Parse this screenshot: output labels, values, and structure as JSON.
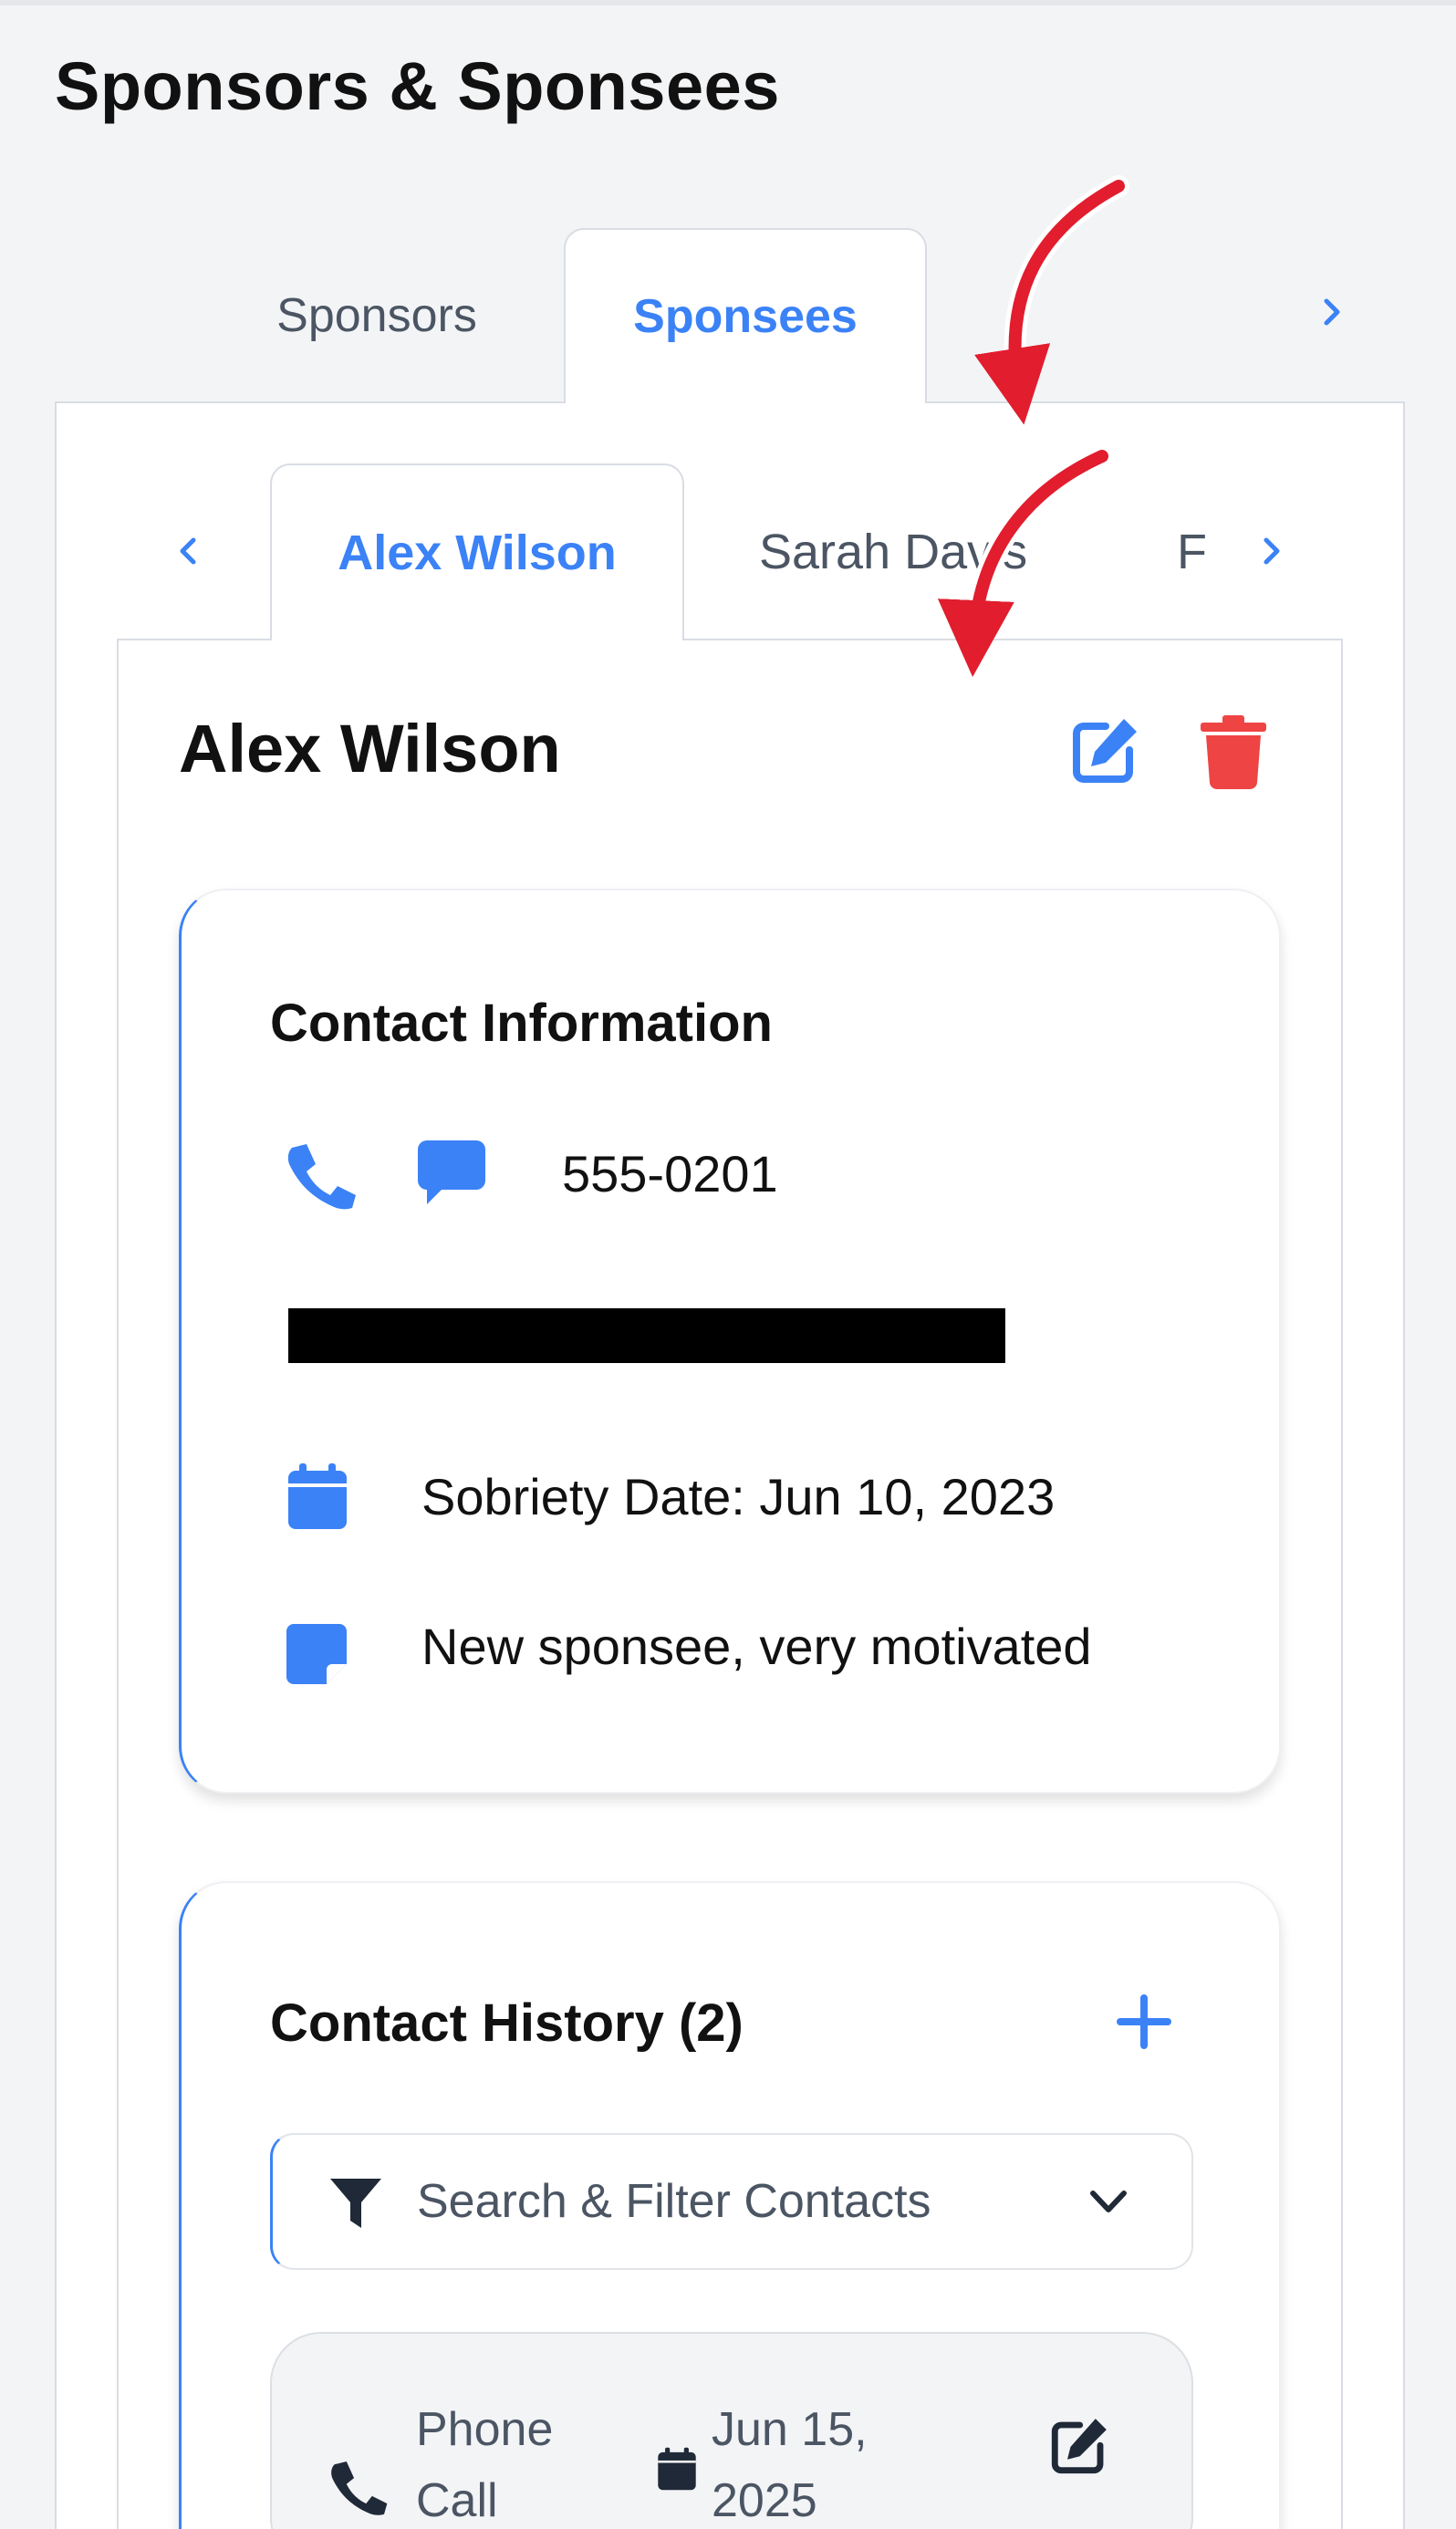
{
  "page": {
    "title": "Sponsors & Sponsees"
  },
  "outer_tabs": [
    {
      "label": "Sponsors",
      "active": false
    },
    {
      "label": "Sponsees",
      "active": true
    }
  ],
  "inner_tabs": [
    {
      "label": "Alex Wilson",
      "active": true
    },
    {
      "label": "Sarah Davis",
      "active": false
    },
    {
      "label": "F",
      "active": false
    }
  ],
  "sponsee": {
    "name": "Alex Wilson",
    "contact_card": {
      "title": "Contact Information",
      "phone": "555-0201",
      "sobriety_date": "Sobriety Date: Jun 10, 2023",
      "note": "New sponsee, very motivated"
    },
    "history_card": {
      "title": "Contact History (2)",
      "filter_label": "Search & Filter Contacts",
      "items": [
        {
          "type_line1": "Phone",
          "type_line2": "Call",
          "date_line1": "Jun 15,",
          "date_line2": "2025"
        }
      ]
    }
  },
  "colors": {
    "accent": "#3b82f6",
    "danger": "#ef4444",
    "annotation_arrow": "#e11d2e",
    "background": "#f3f4f6"
  },
  "icons": [
    "chevron-right-icon",
    "chevron-left-icon",
    "edit-icon",
    "trash-icon",
    "phone-icon",
    "message-icon",
    "calendar-icon",
    "note-icon",
    "plus-icon",
    "filter-icon",
    "chevron-down-icon"
  ]
}
